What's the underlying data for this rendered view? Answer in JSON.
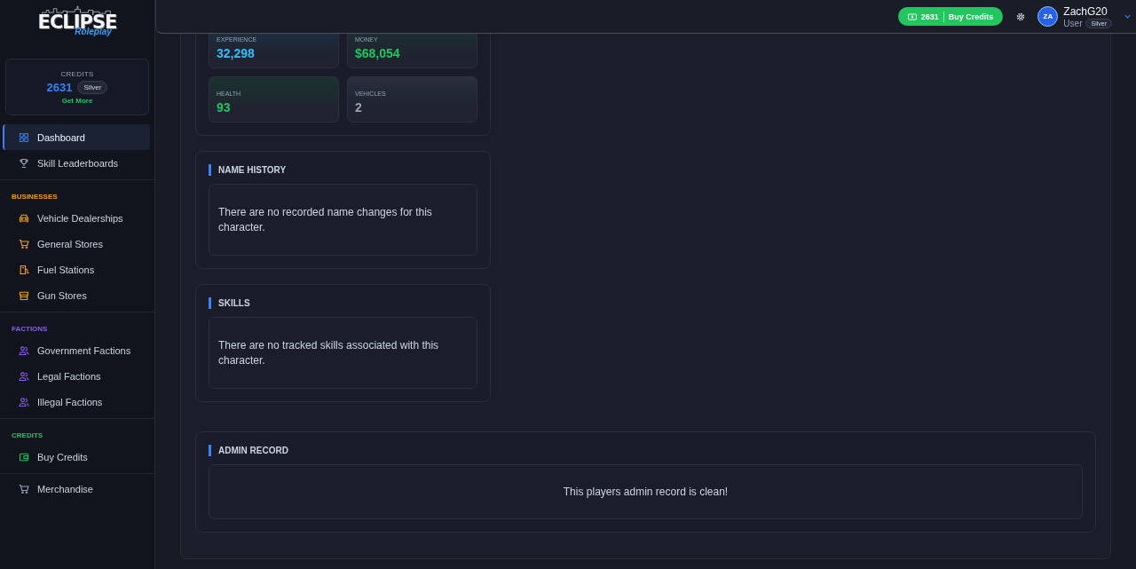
{
  "sidebar": {
    "logo": {
      "name": "ECLIPSE",
      "tagline": "Roleplay"
    },
    "credits": {
      "label": "CREDITS",
      "amount": "2631",
      "tier": "Silver",
      "link": "Get More"
    },
    "groups": [
      {
        "items": [
          {
            "label": "Dashboard",
            "kind": "grid",
            "selected": true
          },
          {
            "label": "Skill Leaderboards",
            "kind": "trophy",
            "selected": false
          }
        ]
      },
      {
        "title": "BUSINESSES",
        "color": "#f59e0b",
        "items": [
          {
            "label": "Vehicle Dealerships",
            "kind": "car",
            "selected": false
          },
          {
            "label": "General Stores",
            "kind": "cart",
            "selected": false
          },
          {
            "label": "Fuel Stations",
            "kind": "fuel",
            "selected": false
          },
          {
            "label": "Gun Stores",
            "kind": "store",
            "selected": false
          }
        ]
      },
      {
        "title": "FACTIONS",
        "color": "#8b5cf6",
        "items": [
          {
            "label": "Government Factions",
            "kind": "users",
            "selected": false
          },
          {
            "label": "Legal Factions",
            "kind": "users",
            "selected": false
          },
          {
            "label": "Illegal Factions",
            "kind": "users",
            "selected": false
          }
        ]
      },
      {
        "title": "CREDITS",
        "color": "#22c55e",
        "items": [
          {
            "label": "Buy Credits",
            "kind": "wallet",
            "selected": false
          }
        ]
      },
      {
        "items": [
          {
            "label": "Merchandise",
            "kind": "cart",
            "selected": false
          }
        ]
      }
    ]
  },
  "header": {
    "buy_button": {
      "credits": "2631",
      "label": "Buy Credits"
    },
    "user": {
      "initials": "ZA",
      "name": "ZachG20",
      "role": "User",
      "tier": "Silver"
    }
  },
  "stats": [
    {
      "label": "EXPERIENCE",
      "value": "32,298",
      "color": "#38bdf8"
    },
    {
      "label": "MONEY",
      "value": "$68,054",
      "color": "#22c55e"
    },
    {
      "label": "HEALTH",
      "value": "93",
      "color": "#22c55e"
    },
    {
      "label": "VEHICLES",
      "value": "2",
      "color": "#94a3b8"
    }
  ],
  "name_history": {
    "title": "NAME HISTORY",
    "message": "There are no recorded name changes for this character."
  },
  "skills": {
    "title": "SKILLS",
    "message": "There are no tracked skills associated with this character."
  },
  "admin_record": {
    "title": "ADMIN RECORD",
    "message": "This players admin record is clean!"
  }
}
